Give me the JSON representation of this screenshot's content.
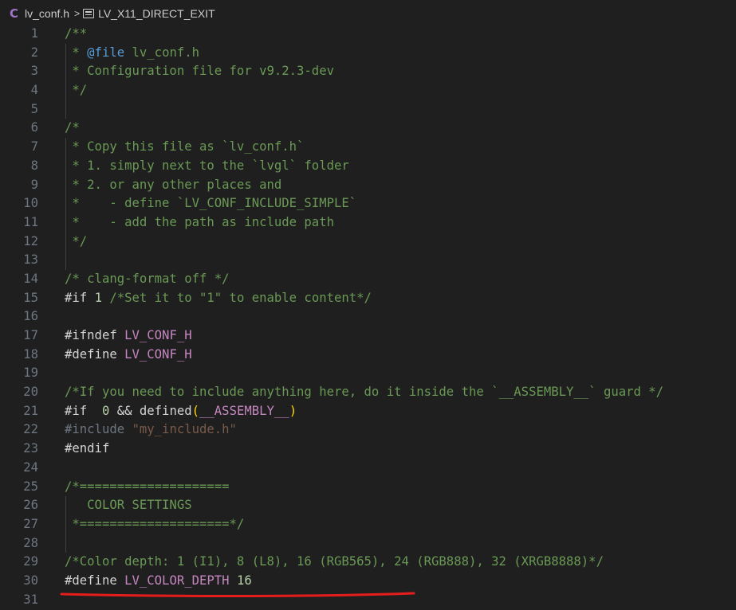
{
  "breadcrumb": {
    "lang_glyph": "C",
    "file": "lv_conf.h",
    "separator": ">",
    "symbol_icon": "symbol-constant-icon",
    "symbol": "LV_X11_DIRECT_EXIT"
  },
  "colors": {
    "background": "#1f1f1f",
    "comment": "#6a9955",
    "preprocessor": "#c586c0",
    "number": "#b5cea8",
    "text": "#d4d4d4",
    "line_number": "#6e7681",
    "annotation": "#e51d1d"
  },
  "lines": [
    {
      "n": "1",
      "guide": false,
      "tokens": [
        {
          "c": "t-comment",
          "t": "/**"
        }
      ]
    },
    {
      "n": "2",
      "guide": true,
      "tokens": [
        {
          "c": "t-comment",
          "t": " * "
        },
        {
          "c": "t-doc",
          "t": "@file"
        },
        {
          "c": "t-comment",
          "t": " lv_conf.h"
        }
      ]
    },
    {
      "n": "3",
      "guide": true,
      "tokens": [
        {
          "c": "t-comment",
          "t": " * Configuration file for v9.2.3-dev"
        }
      ]
    },
    {
      "n": "4",
      "guide": true,
      "tokens": [
        {
          "c": "t-comment",
          "t": " */"
        }
      ]
    },
    {
      "n": "5",
      "guide": true,
      "tokens": []
    },
    {
      "n": "6",
      "guide": false,
      "tokens": [
        {
          "c": "t-comment",
          "t": "/*"
        }
      ]
    },
    {
      "n": "7",
      "guide": true,
      "tokens": [
        {
          "c": "t-comment",
          "t": " * Copy this file as `lv_conf.h`"
        }
      ]
    },
    {
      "n": "8",
      "guide": true,
      "tokens": [
        {
          "c": "t-comment",
          "t": " * 1. simply next to the `lvgl` folder"
        }
      ]
    },
    {
      "n": "9",
      "guide": true,
      "tokens": [
        {
          "c": "t-comment",
          "t": " * 2. or any other places and"
        }
      ]
    },
    {
      "n": "10",
      "guide": true,
      "tokens": [
        {
          "c": "t-comment",
          "t": " *    - define `LV_CONF_INCLUDE_SIMPLE`"
        }
      ]
    },
    {
      "n": "11",
      "guide": true,
      "tokens": [
        {
          "c": "t-comment",
          "t": " *    - add the path as include path"
        }
      ]
    },
    {
      "n": "12",
      "guide": true,
      "tokens": [
        {
          "c": "t-comment",
          "t": " */"
        }
      ]
    },
    {
      "n": "13",
      "guide": true,
      "tokens": []
    },
    {
      "n": "14",
      "guide": false,
      "tokens": [
        {
          "c": "t-comment",
          "t": "/* clang-format off */"
        }
      ]
    },
    {
      "n": "15",
      "guide": false,
      "tokens": [
        {
          "c": "t-plain",
          "t": "#if "
        },
        {
          "c": "t-num",
          "t": "1"
        },
        {
          "c": "t-comment",
          "t": " /*Set it to \"1\" to enable content*/"
        }
      ]
    },
    {
      "n": "16",
      "guide": false,
      "tokens": []
    },
    {
      "n": "17",
      "guide": false,
      "tokens": [
        {
          "c": "t-plain",
          "t": "#ifndef "
        },
        {
          "c": "t-macro",
          "t": "LV_CONF_H"
        }
      ]
    },
    {
      "n": "18",
      "guide": false,
      "tokens": [
        {
          "c": "t-plain",
          "t": "#define "
        },
        {
          "c": "t-macro",
          "t": "LV_CONF_H"
        }
      ]
    },
    {
      "n": "19",
      "guide": false,
      "tokens": []
    },
    {
      "n": "20",
      "guide": false,
      "tokens": [
        {
          "c": "t-comment",
          "t": "/*If you need to include anything here, do it inside the `__ASSEMBLY__` guard */"
        }
      ]
    },
    {
      "n": "21",
      "guide": false,
      "tokens": [
        {
          "c": "t-plain",
          "t": "#if  "
        },
        {
          "c": "t-num",
          "t": "0"
        },
        {
          "c": "t-plain",
          "t": " && defined"
        },
        {
          "c": "t-paren",
          "t": "("
        },
        {
          "c": "t-macro",
          "t": "__ASSEMBLY__"
        },
        {
          "c": "t-paren",
          "t": ")"
        }
      ]
    },
    {
      "n": "22",
      "guide": false,
      "tokens": [
        {
          "c": "t-inactive",
          "t": "#include "
        },
        {
          "c": "t-inactive-str",
          "t": "\"my_include.h\""
        }
      ]
    },
    {
      "n": "23",
      "guide": false,
      "tokens": [
        {
          "c": "t-plain",
          "t": "#endif"
        }
      ]
    },
    {
      "n": "24",
      "guide": false,
      "tokens": []
    },
    {
      "n": "25",
      "guide": false,
      "tokens": [
        {
          "c": "t-comment",
          "t": "/*===================="
        }
      ]
    },
    {
      "n": "26",
      "guide": true,
      "tokens": [
        {
          "c": "t-comment",
          "t": "   COLOR SETTINGS"
        }
      ]
    },
    {
      "n": "27",
      "guide": true,
      "tokens": [
        {
          "c": "t-comment",
          "t": " *====================*/"
        }
      ]
    },
    {
      "n": "28",
      "guide": true,
      "tokens": []
    },
    {
      "n": "29",
      "guide": false,
      "tokens": [
        {
          "c": "t-comment",
          "t": "/*Color depth: 1 (I1), 8 (L8), 16 (RGB565), 24 (RGB888), 32 (XRGB8888)*/"
        }
      ]
    },
    {
      "n": "30",
      "guide": false,
      "tokens": [
        {
          "c": "t-plain",
          "t": "#define "
        },
        {
          "c": "t-macro",
          "t": "LV_COLOR_DEPTH"
        },
        {
          "c": "t-plain",
          "t": " "
        },
        {
          "c": "t-num",
          "t": "16"
        }
      ]
    },
    {
      "n": "31",
      "guide": false,
      "tokens": []
    }
  ]
}
